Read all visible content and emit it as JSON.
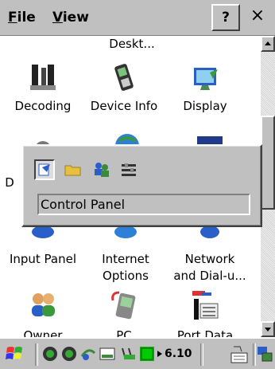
{
  "menubar": {
    "file_label": "File",
    "file_key": "F",
    "file_rest": "ile",
    "view_label": "View",
    "view_key": "V",
    "view_rest": "iew",
    "help_label": "?",
    "close_label": "×"
  },
  "icons": [
    {
      "label": "Deskt...",
      "icon": "desktop-icon"
    },
    {
      "label": "Decoding",
      "icon": "decoding-icon"
    },
    {
      "label": "Device Info",
      "icon": "device-info-icon"
    },
    {
      "label": "Display",
      "icon": "display-icon"
    },
    {
      "label": "D",
      "icon": "hidden-icon"
    },
    {
      "label": "Input Panel",
      "icon": "input-panel-icon"
    },
    {
      "label": "Internet",
      "label2": "Options",
      "icon": "internet-options-icon"
    },
    {
      "label": "Network",
      "label2": "and Dial-u...",
      "icon": "network-icon"
    },
    {
      "label": "Owner",
      "icon": "owner-icon"
    },
    {
      "label": "PC",
      "icon": "pc-icon"
    },
    {
      "label": "Port Data",
      "icon": "port-data-icon"
    }
  ],
  "popup": {
    "label": "Control Panel",
    "tools": [
      "control-panel-icon",
      "folder-icon",
      "users-icon",
      "settings-icon"
    ]
  },
  "taskbar": {
    "clock": "6.10",
    "icons": [
      "start-icon",
      "network-status-icon",
      "network-status-icon-2",
      "sync-icon",
      "keyboard-icon",
      "battery-icon",
      "signal-icon",
      "input-method-icon",
      "desktop-switch-icon"
    ]
  },
  "colors": {
    "chrome": "#c0c0c0",
    "accent_blue": "#2a5ec8",
    "accent_green": "#3a8a3a"
  }
}
